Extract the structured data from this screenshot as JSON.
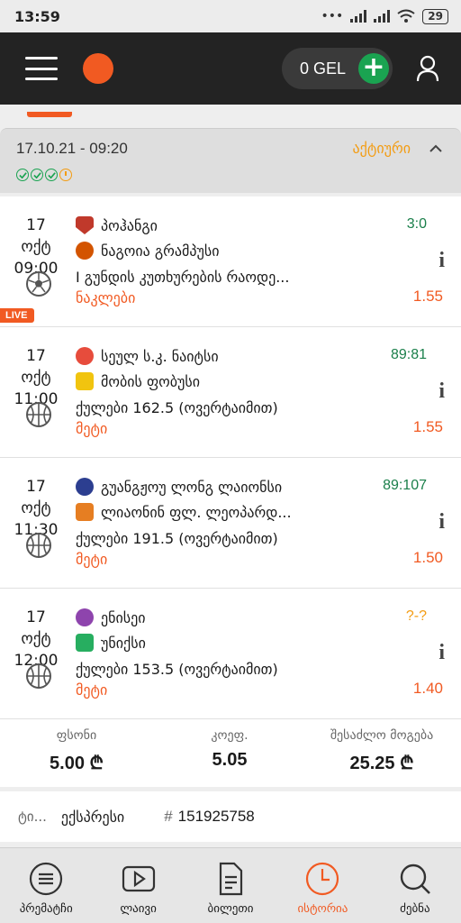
{
  "status_bar": {
    "time": "13:59",
    "battery": "29"
  },
  "header": {
    "balance": "0 GEL"
  },
  "bet": {
    "date": "17.10.21 - 09:20",
    "status": "აქტიური",
    "status_color": "#f39c12"
  },
  "events": [
    {
      "date": "17 ოქტ",
      "time": "09:00",
      "sport_icon": "football-icon",
      "live": "LIVE",
      "team1": "პოჰანგი",
      "team2": "ნაგოია გრამპუსი",
      "market": "I გუნდის კუთხურების რაოდე...",
      "pick": "ნაკლები",
      "score": "3:0",
      "score_color": "#1a7f4a",
      "odd": "1.55"
    },
    {
      "date": "17 ოქტ",
      "time": "11:00",
      "sport_icon": "basketball-icon",
      "team1": "სეულ ს.კ. ნაიტსი",
      "team2": "მობის ფობუსი",
      "market": "ქულები 162.5 (ოვერტაიმით)",
      "pick": "მეტი",
      "score": "89:81",
      "score_color": "#1a7f4a",
      "odd": "1.55"
    },
    {
      "date": "17 ოქტ",
      "time": "11:30",
      "sport_icon": "basketball-icon",
      "team1": "გუანგჟოუ ლონგ ლაიონსი",
      "team2": "ლიაონინ ფლ. ლეოპარდ...",
      "market": "ქულები 191.5 (ოვერტაიმით)",
      "pick": "მეტი",
      "score": "89:107",
      "score_color": "#1a7f4a",
      "odd": "1.50"
    },
    {
      "date": "17 ოქტ",
      "time": "12:00",
      "sport_icon": "basketball-icon",
      "team1": "ენისეი",
      "team2": "უნიქსი",
      "market": "ქულები 153.5 (ოვერტაიმით)",
      "pick": "მეტი",
      "score": "?-?",
      "score_color": "#f39c12",
      "odd": "1.40"
    }
  ],
  "summary": {
    "stake_label": "ფსონი",
    "stake_value": "5.00 ₾",
    "coef_label": "კოეფ.",
    "coef_value": "5.05",
    "win_label": "შესაძლო მოგება",
    "win_value": "25.25 ₾"
  },
  "ticket": {
    "type_label": "ტი...",
    "type_value": "ექსპრესი",
    "number": "151925758"
  },
  "nav": [
    {
      "label": "პრემატჩი",
      "icon": "prematch-icon"
    },
    {
      "label": "ლაივი",
      "icon": "live-play-icon"
    },
    {
      "label": "ბილეთი",
      "icon": "ticket-icon"
    },
    {
      "label": "ისტორია",
      "icon": "history-clock-icon",
      "active": true
    },
    {
      "label": "ძებნა",
      "icon": "search-icon"
    }
  ],
  "colors": {
    "accent": "#f15a22",
    "success": "#1aa351",
    "header_bg": "#232323"
  }
}
